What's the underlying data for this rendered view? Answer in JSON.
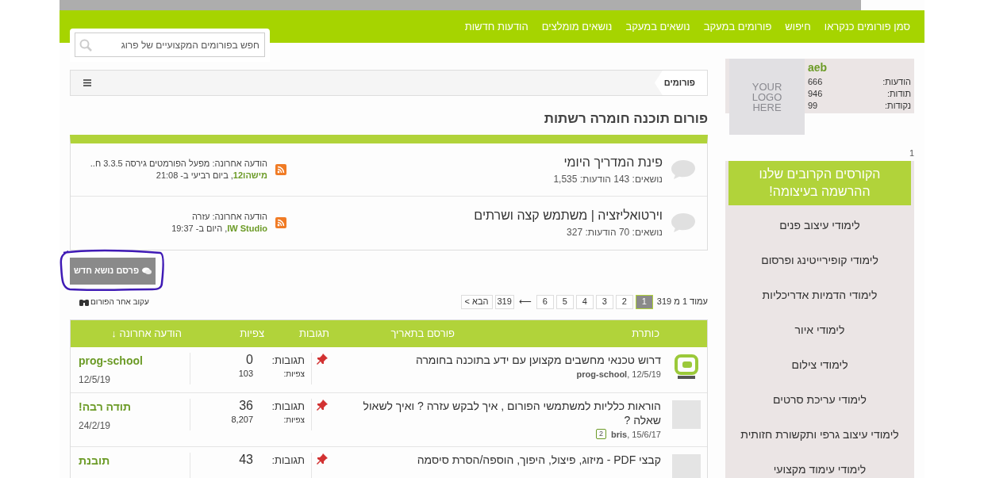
{
  "nav": {
    "items": [
      "סמן פורומים כנקראו",
      "חיפוש",
      "פורומים במעקב",
      "נושאים במעקב",
      "נושאים מומלצים",
      "הודעות חדשות"
    ]
  },
  "search": {
    "placeholder": "חפש בפורומים המקצועיים של פרוג"
  },
  "profile": {
    "name": "aeb",
    "logo": "YOUR LOGO HERE",
    "stats": [
      {
        "label": "הודעות:",
        "value": "666"
      },
      {
        "label": "תודות:",
        "value": "946"
      },
      {
        "label": "נקודות:",
        "value": "99"
      }
    ]
  },
  "sidebar_counter": "1",
  "courses": {
    "title": "הקורסים הקרובים שלנו ההרשמה בעיצומה!",
    "items": [
      "לימודי עיצוב פנים",
      "לימודי קופירייטינג ופרסום",
      "לימודי הדמיות אדריכליות",
      "לימודי איור",
      "לימודי צילום",
      "לימודי עריכת סרטים",
      "לימודי עיצוב גרפי ותקשורת חזותית",
      "לימודי עימוד מקצועי"
    ]
  },
  "breadcrumb": {
    "items": [
      "פורומים"
    ]
  },
  "forum_title": "פורום תוכנה חומרה רשתות",
  "subforums": [
    {
      "title": "פינת המדריך היומי",
      "stats": "נושאים: 143 הודעות: 1,535",
      "last_label": "הודעה אחרונה: מפעל הפורמטים גירסה 3.3.5 ח..",
      "last_user": "מישהו12",
      "last_time": ", ביום רביעי ב- 21:08"
    },
    {
      "title": "וירטואליזציה | משתמש קצה ושרתים",
      "stats": "נושאים: 70 הודעות: 327",
      "last_label": "הודעה אחרונה: עזרה",
      "last_user": "IW Studio",
      "last_time": ", היום ב- 19:37"
    }
  ],
  "new_topic_button": "פרסם נושא חדש",
  "follow_link": "עקוב אחר הפורום",
  "pagination": {
    "label": "עמוד 1 מ 319",
    "pages": [
      {
        "label": "1",
        "selected": true
      },
      {
        "label": "2",
        "selected": false
      },
      {
        "label": "3",
        "selected": false
      },
      {
        "label": "4",
        "selected": false
      },
      {
        "label": "5",
        "selected": false
      },
      {
        "label": "6",
        "selected": false
      }
    ],
    "separator": "⟵",
    "last": "319",
    "next": "הבא >"
  },
  "table": {
    "columns": [
      "כותרת",
      "פורסם בתאריך",
      "תגובות",
      "צפיות",
      "הודעה אחרונה ↓"
    ],
    "rows": [
      {
        "kind": "prog",
        "title": "דרוש טכנאי מחשבים מקצוען עם ידע בתוכנה בחומרה",
        "author": "prog-school",
        "date": ", 12/5/19",
        "pages": [],
        "pinned": true,
        "replies_label": "תגובות:",
        "replies": "0",
        "views_label": "צפיות:",
        "views": "103",
        "last_user": "prog-school",
        "last_date": "12/5/19"
      },
      {
        "kind": "placeholder",
        "title": "הוראות כלליות למשתמשי הפורום , איך לבקש עזרה ? ואיך לשאול שאלה ?",
        "author": "bris",
        "date": ", 15/6/17",
        "pages": [
          "2"
        ],
        "pinned": true,
        "replies_label": "תגובות:",
        "replies": "36",
        "views_label": "צפיות:",
        "views": "8,207",
        "last_user": "תודה רבה!",
        "last_date": "24/2/19"
      },
      {
        "kind": "placeholder",
        "title": "קבצי PDF - מיזוג, פיצול, היפוך, הוספה/הסרת סיסמה",
        "pinned": true,
        "replies_label": "תגובות:",
        "replies": "43",
        "last_user": "תובנת"
      }
    ]
  }
}
